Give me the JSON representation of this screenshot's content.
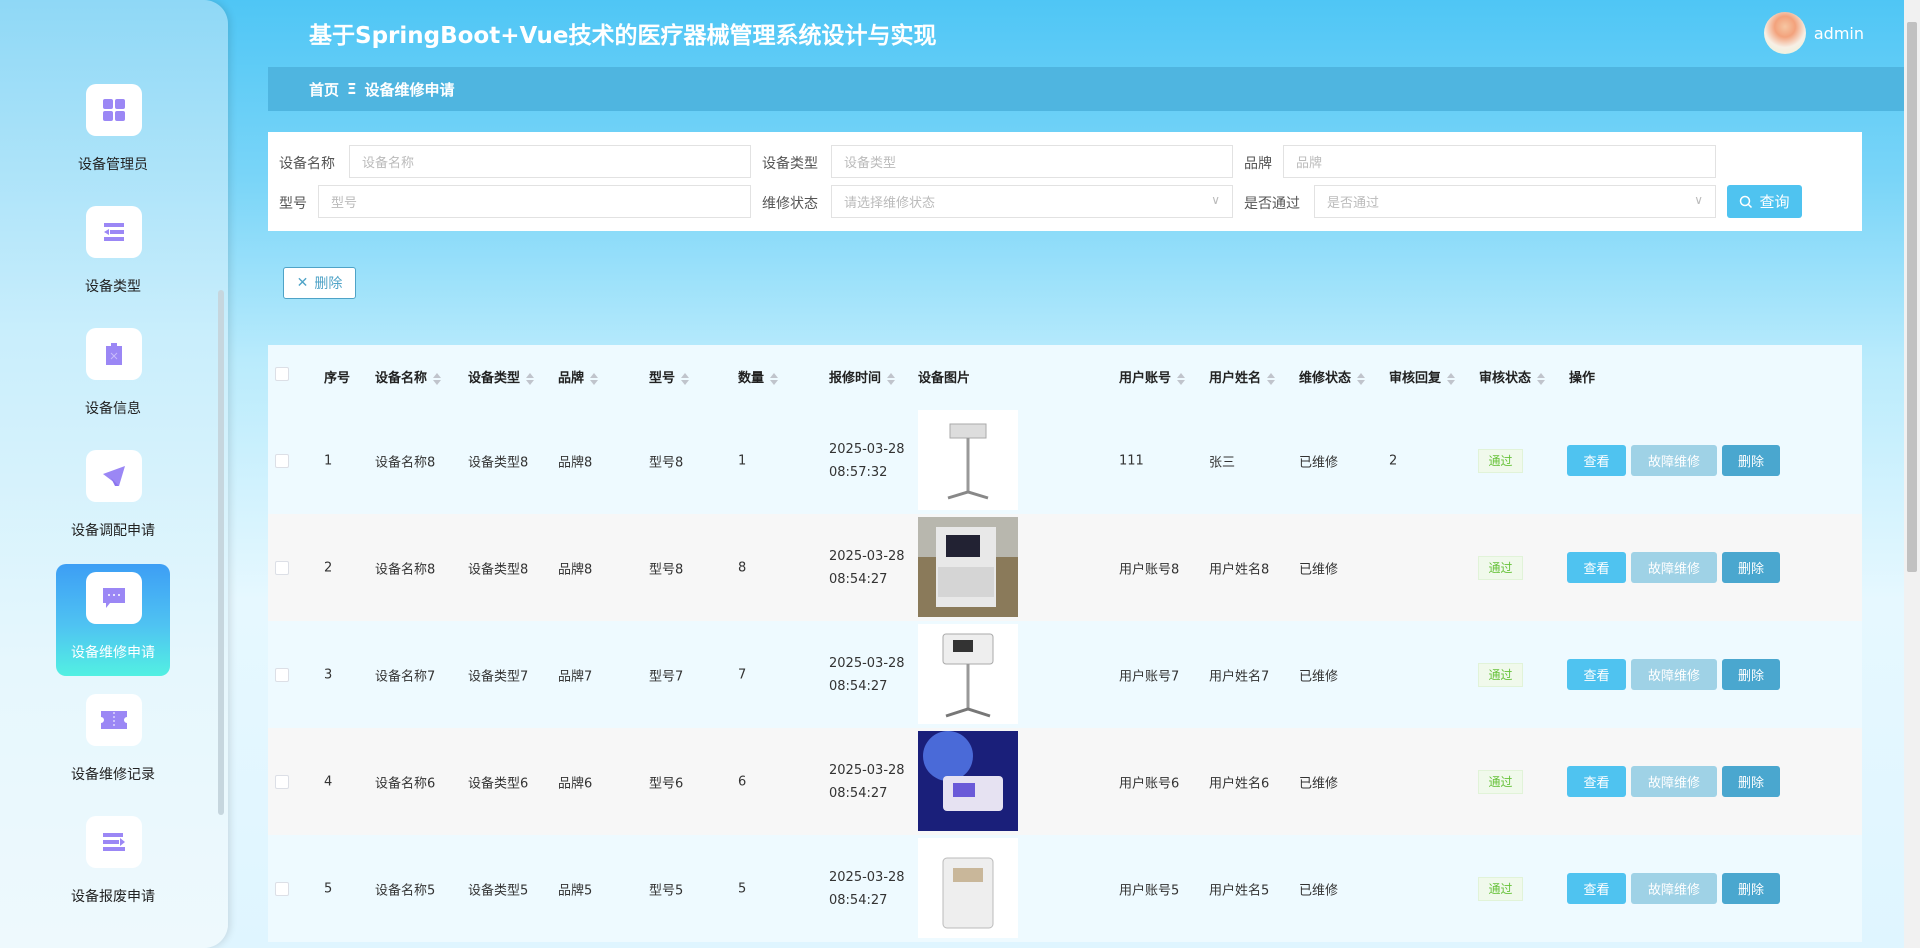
{
  "header": {
    "title": "基于SpringBoot+Vue技术的医疗器械管理系统设计与实现",
    "username": "admin"
  },
  "breadcrumb": {
    "home": "首页",
    "separator": "Ξ",
    "current": "设备维修申请"
  },
  "sidebar": {
    "items": [
      {
        "label": "设备管理员",
        "icon": "grid-icon"
      },
      {
        "label": "设备类型",
        "icon": "list-icon"
      },
      {
        "label": "设备信息",
        "icon": "clipboard-icon"
      },
      {
        "label": "设备调配申请",
        "icon": "paper-plane-icon"
      },
      {
        "label": "设备维修申请",
        "icon": "chat-icon",
        "active": true
      },
      {
        "label": "设备维修记录",
        "icon": "ticket-icon"
      },
      {
        "label": "设备报废申请",
        "icon": "list-arrow-icon"
      }
    ]
  },
  "search": {
    "name_label": "设备名称",
    "name_placeholder": "设备名称",
    "type_label": "设备类型",
    "type_placeholder": "设备类型",
    "brand_label": "品牌",
    "brand_placeholder": "品牌",
    "model_label": "型号",
    "model_placeholder": "型号",
    "status_label": "维修状态",
    "status_placeholder": "请选择维修状态",
    "pass_label": "是否通过",
    "pass_placeholder": "是否通过",
    "query_label": "查询"
  },
  "toolbar": {
    "delete_label": "删除"
  },
  "table": {
    "columns": [
      "序号",
      "设备名称",
      "设备类型",
      "品牌",
      "型号",
      "数量",
      "报修时间",
      "设备图片",
      "用户账号",
      "用户姓名",
      "维修状态",
      "审核回复",
      "审核状态",
      "操作"
    ],
    "actions": {
      "view": "查看",
      "repair": "故障维修",
      "delete": "删除"
    },
    "rows": [
      {
        "no": "1",
        "name": "设备名称8",
        "type": "设备类型8",
        "brand": "品牌8",
        "model": "型号8",
        "qty": "1",
        "date": "2025-03-28",
        "time": "08:57:32",
        "account": "111",
        "username": "张三",
        "status": "已维修",
        "reply": "2",
        "audit": "通过"
      },
      {
        "no": "2",
        "name": "设备名称8",
        "type": "设备类型8",
        "brand": "品牌8",
        "model": "型号8",
        "qty": "8",
        "date": "2025-03-28",
        "time": "08:54:27",
        "account": "用户账号8",
        "username": "用户姓名8",
        "status": "已维修",
        "reply": "",
        "audit": "通过"
      },
      {
        "no": "3",
        "name": "设备名称7",
        "type": "设备类型7",
        "brand": "品牌7",
        "model": "型号7",
        "qty": "7",
        "date": "2025-03-28",
        "time": "08:54:27",
        "account": "用户账号7",
        "username": "用户姓名7",
        "status": "已维修",
        "reply": "",
        "audit": "通过"
      },
      {
        "no": "4",
        "name": "设备名称6",
        "type": "设备类型6",
        "brand": "品牌6",
        "model": "型号6",
        "qty": "6",
        "date": "2025-03-28",
        "time": "08:54:27",
        "account": "用户账号6",
        "username": "用户姓名6",
        "status": "已维修",
        "reply": "",
        "audit": "通过"
      },
      {
        "no": "5",
        "name": "设备名称5",
        "type": "设备类型5",
        "brand": "品牌5",
        "model": "型号5",
        "qty": "5",
        "date": "2025-03-28",
        "time": "08:54:27",
        "account": "用户账号5",
        "username": "用户姓名5",
        "status": "已维修",
        "reply": "",
        "audit": "通过"
      }
    ]
  },
  "colors": {
    "accent": "#4fc3f0",
    "breadcrumb": "#4fb5e0",
    "icon": "#9b87f5",
    "success": "#67c23a"
  }
}
